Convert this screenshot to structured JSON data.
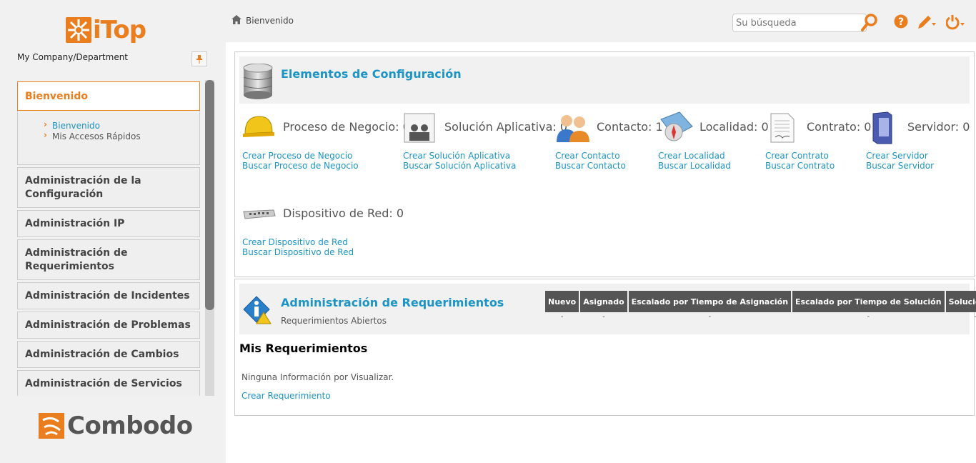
{
  "app": {
    "logo_text": "iTop",
    "footer_logo_text": "Combodo"
  },
  "sidebar": {
    "organization": "My Company/Department",
    "menu": [
      {
        "label": "Bienvenido",
        "active": true,
        "children": [
          {
            "label": "Bienvenido",
            "active": true
          },
          {
            "label": "Mis Accesos Rápidos",
            "active": false
          }
        ]
      },
      {
        "label": "Administración de la Configuración"
      },
      {
        "label": "Administración IP"
      },
      {
        "label": "Administración de Requerimientos"
      },
      {
        "label": "Administración de Incidentes"
      },
      {
        "label": "Administración de Problemas"
      },
      {
        "label": "Administración de Cambios"
      },
      {
        "label": "Administración de Servicios"
      }
    ]
  },
  "header": {
    "breadcrumb": "Bienvenido",
    "search_placeholder": "Su búsqueda",
    "icons": [
      "search-icon",
      "help-icon",
      "edit-icon",
      "power-icon"
    ]
  },
  "config_panel": {
    "title": "Elementos de Configuración",
    "items": [
      {
        "label": "Proceso de Negocio: 0",
        "create": "Crear Proceso de Negocio",
        "search": "Buscar Proceso de Negocio",
        "icon": "hardhat-icon"
      },
      {
        "label": "Solución Aplicativa: 0",
        "create": "Crear Solución Aplicativa",
        "search": "Buscar Solución Aplicativa",
        "icon": "people-frame-icon"
      },
      {
        "label": "Contacto: 1",
        "create": "Crear Contacto",
        "search": "Buscar Contacto",
        "icon": "contacts-icon"
      },
      {
        "label": "Localidad: 0",
        "create": "Crear Localidad",
        "search": "Buscar Localidad",
        "icon": "compass-map-icon"
      },
      {
        "label": "Contrato: 0",
        "create": "Crear Contrato",
        "search": "Buscar Contrato",
        "icon": "contract-icon"
      },
      {
        "label": "Servidor: 0",
        "create": "Crear Servidor",
        "search": "Buscar Servidor",
        "icon": "server-icon"
      },
      {
        "label": "Dispositivo de Red: 0",
        "create": "Crear Dispositivo de Red",
        "search": "Buscar Dispositivo de Red",
        "icon": "network-switch-icon"
      }
    ]
  },
  "requests_panel": {
    "title": "Administración de Requerimientos",
    "subtitle": "Requerimientos Abiertos",
    "columns": [
      "Nuevo",
      "Asignado",
      "Escalado por Tiempo de Asignación",
      "Escalado por Tiempo de Solución",
      "Solucionado"
    ],
    "values": [
      "-",
      "-",
      "-",
      "-",
      "-"
    ],
    "my_title": "Mis Requerimientos",
    "empty_text": "Ninguna Información por Visualizar.",
    "create_link": "Crear Requerimiento"
  },
  "colors": {
    "accent": "#ea7d1e",
    "link": "#1c94c4",
    "panel_bg": "#f1f1f1"
  }
}
